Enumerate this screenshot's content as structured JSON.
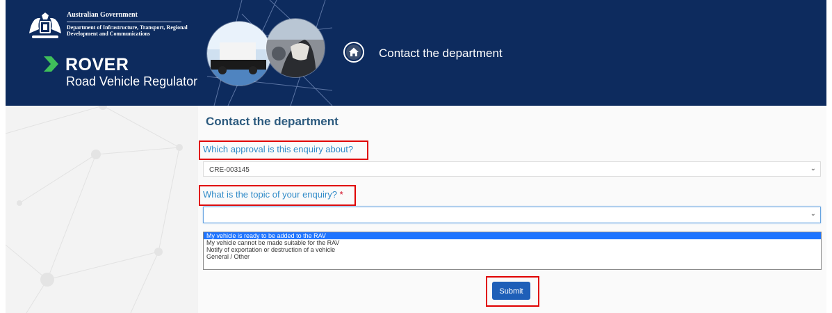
{
  "header": {
    "gov_name": "Australian Government",
    "department": "Department of Infrastructure, Transport, Regional Development and Communications",
    "app_name": "ROVER",
    "app_subtitle": "Road Vehicle Regulator",
    "page_title": "Contact the department",
    "home_icon": "home-icon"
  },
  "form": {
    "title": "Contact the department",
    "approval_label": "Which approval is this enquiry about?",
    "approval_value": "CRE-003145",
    "topic_label": "What is the topic of your enquiry?",
    "topic_required_mark": "*",
    "topic_value": "",
    "topic_options": [
      "My vehicle is ready to be added to the RAV",
      "My vehicle cannot be made suitable for the RAV",
      "Notify of exportation or destruction of a vehicle",
      "General / Other"
    ],
    "topic_selected_index": 0,
    "submit_label": "Submit"
  },
  "colors": {
    "header_bg": "#0d2b5e",
    "title": "#2c5a7e",
    "label": "#2f8ac8",
    "highlight": "#e00000",
    "submit_bg": "#1e5fb8",
    "option_selected": "#1e74ff"
  }
}
